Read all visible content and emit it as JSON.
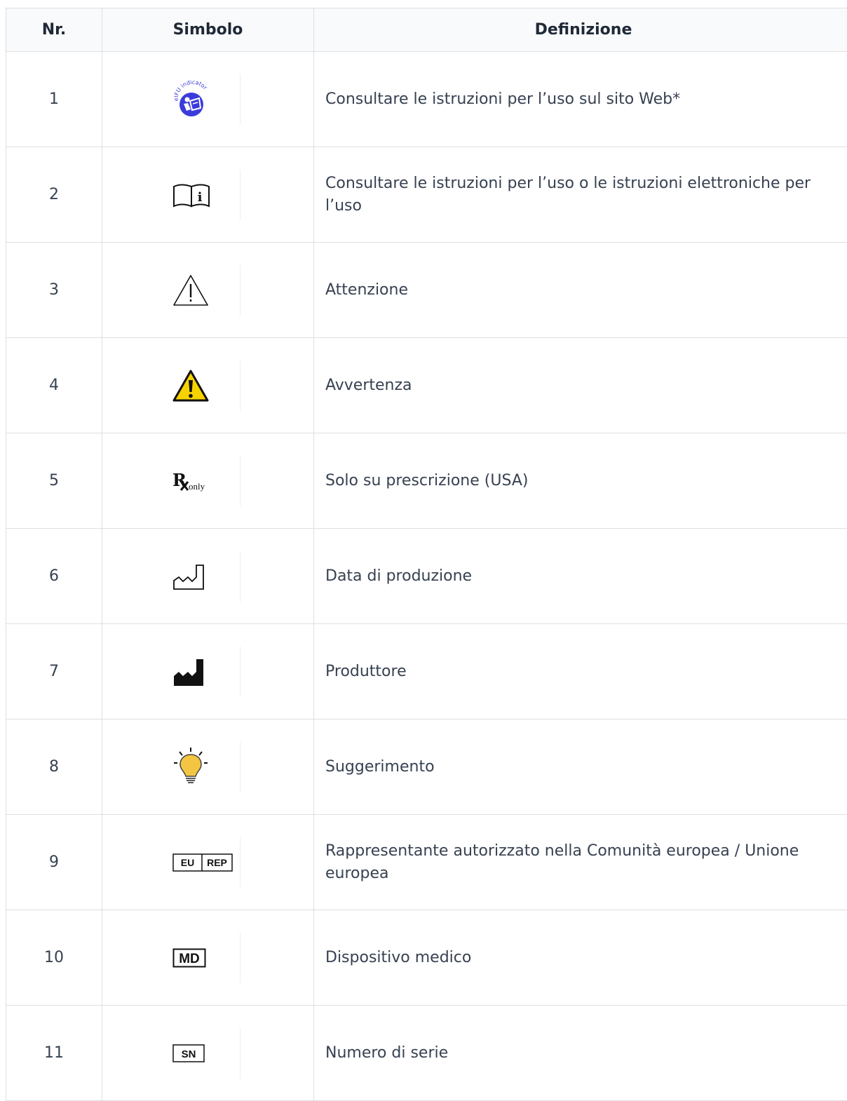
{
  "headers": {
    "nr": "Nr.",
    "symbol": "Simbolo",
    "definition": "Definizione"
  },
  "rows": [
    {
      "nr": "1",
      "icon": "eifu-indicator-icon",
      "icon_text": "eIFU indicator",
      "definition": "Consultare le istruzioni per l’uso sul sito Web*"
    },
    {
      "nr": "2",
      "icon": "consult-instructions-icon",
      "definition": "Consultare le istruzioni per l’uso o le istruzioni elettroniche per l’uso"
    },
    {
      "nr": "3",
      "icon": "caution-icon",
      "definition": "Attenzione"
    },
    {
      "nr": "4",
      "icon": "warning-icon",
      "definition": "Avvertenza"
    },
    {
      "nr": "5",
      "icon": "rx-only-icon",
      "icon_text": "only",
      "definition": "Solo su prescrizione (USA)"
    },
    {
      "nr": "6",
      "icon": "date-of-manufacture-icon",
      "definition": "Data di produzione"
    },
    {
      "nr": "7",
      "icon": "manufacturer-icon",
      "definition": "Produttore"
    },
    {
      "nr": "8",
      "icon": "tip-lightbulb-icon",
      "definition": "Suggerimento"
    },
    {
      "nr": "9",
      "icon": "eu-rep-icon",
      "icon_text": [
        "EU",
        "REP"
      ],
      "definition": "Rappresentante autorizzato nella Comunità europea / Unione europea"
    },
    {
      "nr": "10",
      "icon": "medical-device-icon",
      "icon_text": "MD",
      "definition": "Dispositivo medico"
    },
    {
      "nr": "11",
      "icon": "serial-number-icon",
      "icon_text": "SN",
      "definition": "Numero di serie"
    }
  ],
  "colors": {
    "eifu_blue": "#3b3bdc",
    "warning_yellow": "#f6d300",
    "bulb_yellow": "#f4c542",
    "border": "#dcdfe3",
    "header_bg": "#f9fafb"
  }
}
